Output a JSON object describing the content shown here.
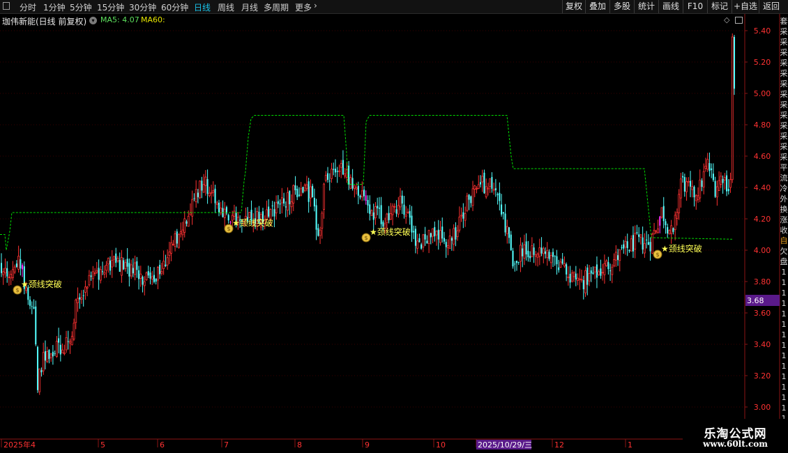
{
  "toolbar": {
    "periods": [
      {
        "label": "分时",
        "active": false
      },
      {
        "label": "1分钟",
        "active": false
      },
      {
        "label": "5分钟",
        "active": false
      },
      {
        "label": "15分钟",
        "active": false
      },
      {
        "label": "30分钟",
        "active": false
      },
      {
        "label": "60分钟",
        "active": false
      },
      {
        "label": "日线",
        "active": true
      },
      {
        "label": "周线",
        "active": false
      },
      {
        "label": "月线",
        "active": false
      },
      {
        "label": "多周期",
        "active": false
      },
      {
        "label": "更多",
        "active": false
      }
    ],
    "right_buttons": [
      "复权",
      "叠加",
      "多股",
      "统计",
      "画线",
      "F10",
      "标记",
      "+自选",
      "返回"
    ]
  },
  "info": {
    "title": "珈伟新能(日线 前复权)",
    "ma5": "MA5: 4.07",
    "ma60": "MA60:"
  },
  "chart_data": {
    "type": "candlestick",
    "y_axis_labels": [
      "5.40",
      "5.20",
      "5.00",
      "4.80",
      "4.60",
      "4.40",
      "4.20",
      "4.00",
      "3.80",
      "3.60",
      "3.40",
      "3.20",
      "3.00"
    ],
    "ylim": [
      2.93,
      5.45
    ],
    "x_axis_labels": [
      "2025年4",
      "5",
      "6",
      "7",
      "8",
      "9",
      "10",
      "2025/10/29/三",
      "12",
      "1"
    ],
    "cursor_price": "3.68",
    "cursor_date": "2025/10/29/三",
    "signal_label": "★颈线突破",
    "up_color": "#ff3232",
    "down_color": "#54ffff",
    "breakout_color": "#ff30ff",
    "ma60_color": "#00dd00",
    "axis_color": "#8b1515",
    "grid_color": "#3a0000",
    "signal_text_color": "#ffff55"
  },
  "right_strip": [
    "套",
    "采",
    "采",
    "采",
    "采",
    "采",
    "采",
    "采",
    "采",
    "采",
    "采",
    "采",
    "采",
    "采",
    "平",
    "流",
    "冷",
    "外",
    "换",
    "涨",
    "收",
    "自",
    "欠",
    "盘",
    "1",
    "1",
    "1",
    "1",
    "1",
    "1",
    "1",
    "1",
    "1",
    "1",
    "1",
    "1",
    "1",
    "1",
    "1"
  ],
  "watermark": {
    "title": "乐淘公式网",
    "url": "www.60lt.com"
  }
}
